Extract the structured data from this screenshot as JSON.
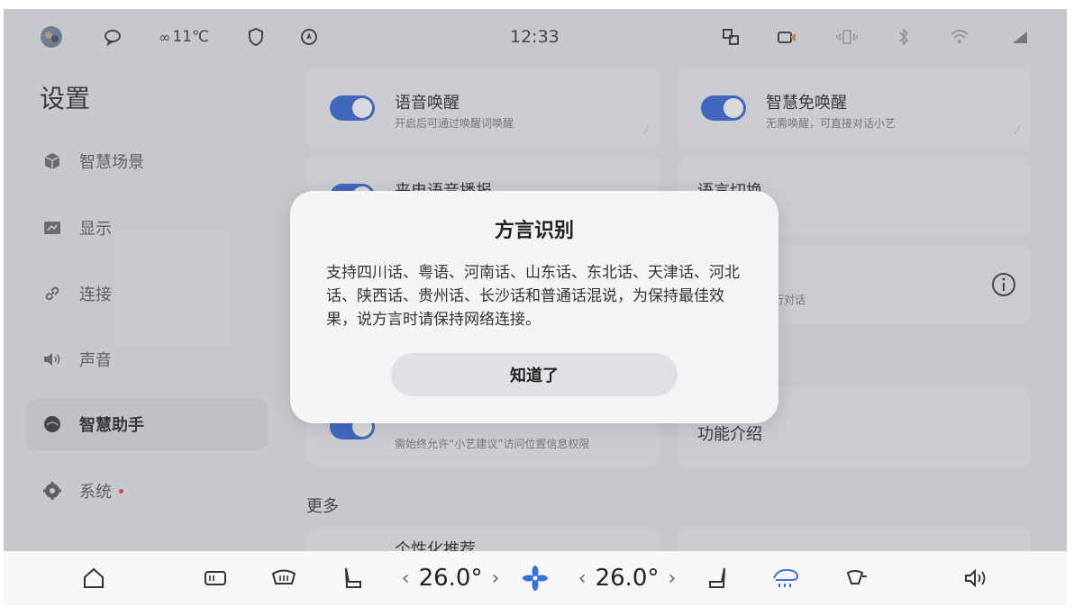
{
  "status_bar": {
    "weather": "11℃",
    "time": "12:33"
  },
  "sidebar": {
    "title": "设置",
    "items": [
      {
        "label": "智慧场景",
        "icon": "cube-icon"
      },
      {
        "label": "显示",
        "icon": "display-icon"
      },
      {
        "label": "连接",
        "icon": "link-icon"
      },
      {
        "label": "声音",
        "icon": "speaker-icon"
      },
      {
        "label": "智慧助手",
        "icon": "assistant-icon",
        "active": true
      },
      {
        "label": "系统",
        "icon": "gear-icon",
        "badge": true
      }
    ]
  },
  "cards": {
    "voice_wake": {
      "title": "语音唤醒",
      "subtitle": "开启后可通过唤醒词唤醒",
      "enabled": true
    },
    "smart_wake": {
      "title": "智慧免唤醒",
      "subtitle": "无需唤醒，可直接对话小艺",
      "enabled": true
    },
    "call_broadcast": {
      "title": "来电语音播报"
    },
    "language_switch": {
      "title": "语言切换"
    },
    "dialect_hint": {
      "subtitle": "使用多种方言进行对话"
    },
    "location_permission": {
      "subtitle": "需始终允许“小艺建议”访问位置信息权限"
    },
    "feature_intro": {
      "title": "功能介绍"
    },
    "personalized": {
      "title": "个性化推荐"
    }
  },
  "section_more": "更多",
  "dialog": {
    "title": "方言识别",
    "body": "支持四川话、粤语、河南话、山东话、东北话、天津话、河北话、陕西话、贵州话、长沙话和普通话混说，为保持最佳效果，说方言时请保持网络连接。",
    "button": "知道了"
  },
  "dock": {
    "left_temp": "26.0°",
    "right_temp": "26.0°",
    "chevron_left": "‹",
    "chevron_right": "›"
  },
  "colors": {
    "accent": "#2f62d6",
    "fan": "#3a6fe0",
    "badge": "#e23a3a"
  }
}
